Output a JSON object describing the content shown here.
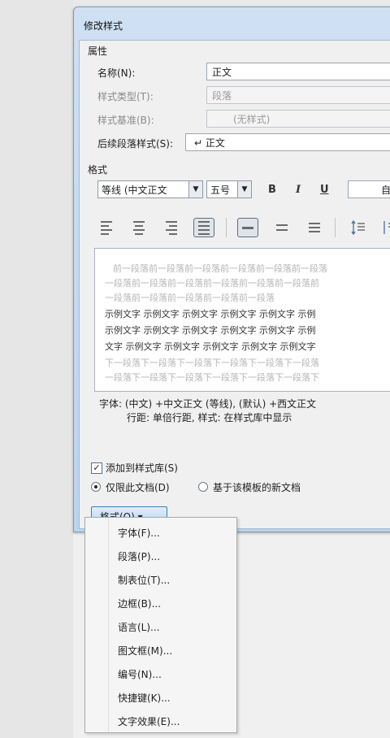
{
  "dialog": {
    "title": "修改样式"
  },
  "properties": {
    "section_label": "属性",
    "name_label": "名称(N):",
    "name_value": "正文",
    "type_label": "样式类型(T):",
    "type_value": "段落",
    "based_on_label": "样式基准(B):",
    "based_on_value": "(无样式)",
    "next_label": "后续段落样式(S):",
    "next_value": "↵ 正文"
  },
  "formatting": {
    "section_label": "格式",
    "font_value": "等线 (中文正文",
    "size_value": "五号",
    "bold_label": "B",
    "italic_label": "I",
    "underline_label": "U",
    "color_value": "自"
  },
  "preview": {
    "prev_para_1": "前一段落前一段落前一段落前一段落前一段落前一段落",
    "prev_para_2": "一段落前一段落前一段落前一段落前一段落前一段落前",
    "prev_para_3": "一段落前一段落前一段落前一段落前一段落",
    "sample_1": "示例文字 示例文字 示例文字 示例文字 示例文字 示例",
    "sample_2": "示例文字 示例文字 示例文字 示例文字 示例文字 示例",
    "sample_3": "文字 示例文字 示例文字 示例文字 示例文字 示例文字",
    "next_para_1": "下一段落下一段落下一段落下一段落下一段落下一段落",
    "next_para_2": "一段落下一段落下一段落下一段落下一段落下一段落下"
  },
  "description": {
    "line1": "字体: (中文) +中文正文 (等线), (默认) +西文正文",
    "line2": "行距: 单倍行距, 样式: 在样式库中显示"
  },
  "options": {
    "add_to_gallery_label": "添加到样式库(S)",
    "add_to_gallery_checked": true,
    "only_this_doc_label": "仅限此文档(D)",
    "new_docs_label": "基于该模板的新文档"
  },
  "format_button": {
    "label": "格式(O) ▾"
  },
  "format_menu": {
    "items": [
      "字体(F)...",
      "段落(P)...",
      "制表位(T)...",
      "边框(B)...",
      "语言(L)...",
      "图文框(M)...",
      "编号(N)...",
      "快捷键(K)...",
      "文字效果(E)..."
    ]
  }
}
